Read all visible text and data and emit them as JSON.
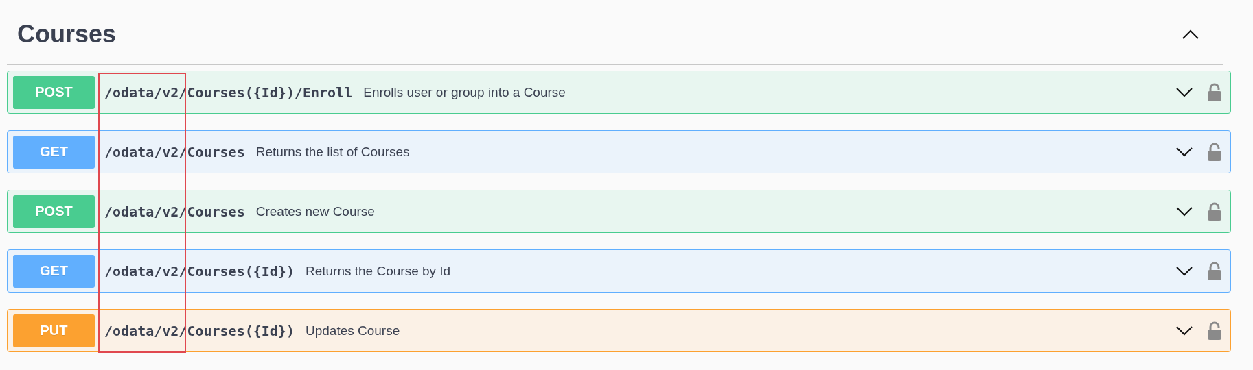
{
  "section": {
    "title": "Courses",
    "expanded": true
  },
  "operations": [
    {
      "kind": "post",
      "method": "POST",
      "path": "/odata/v2/Courses({Id})/Enroll",
      "summary": "Enrolls user or group into a Course",
      "expanded": false,
      "locked": false
    },
    {
      "kind": "get",
      "method": "GET",
      "path": "/odata/v2/Courses",
      "summary": "Returns the list of Courses",
      "expanded": false,
      "locked": false
    },
    {
      "kind": "post",
      "method": "POST",
      "path": "/odata/v2/Courses",
      "summary": "Creates new Course",
      "expanded": false,
      "locked": false
    },
    {
      "kind": "get",
      "method": "GET",
      "path": "/odata/v2/Courses({Id})",
      "summary": "Returns the Course by Id",
      "expanded": false,
      "locked": false
    },
    {
      "kind": "put",
      "method": "PUT",
      "path": "/odata/v2/Courses({Id})",
      "summary": "Updates Course",
      "expanded": false,
      "locked": false
    }
  ],
  "annotation": {
    "kind": "rectangle"
  }
}
